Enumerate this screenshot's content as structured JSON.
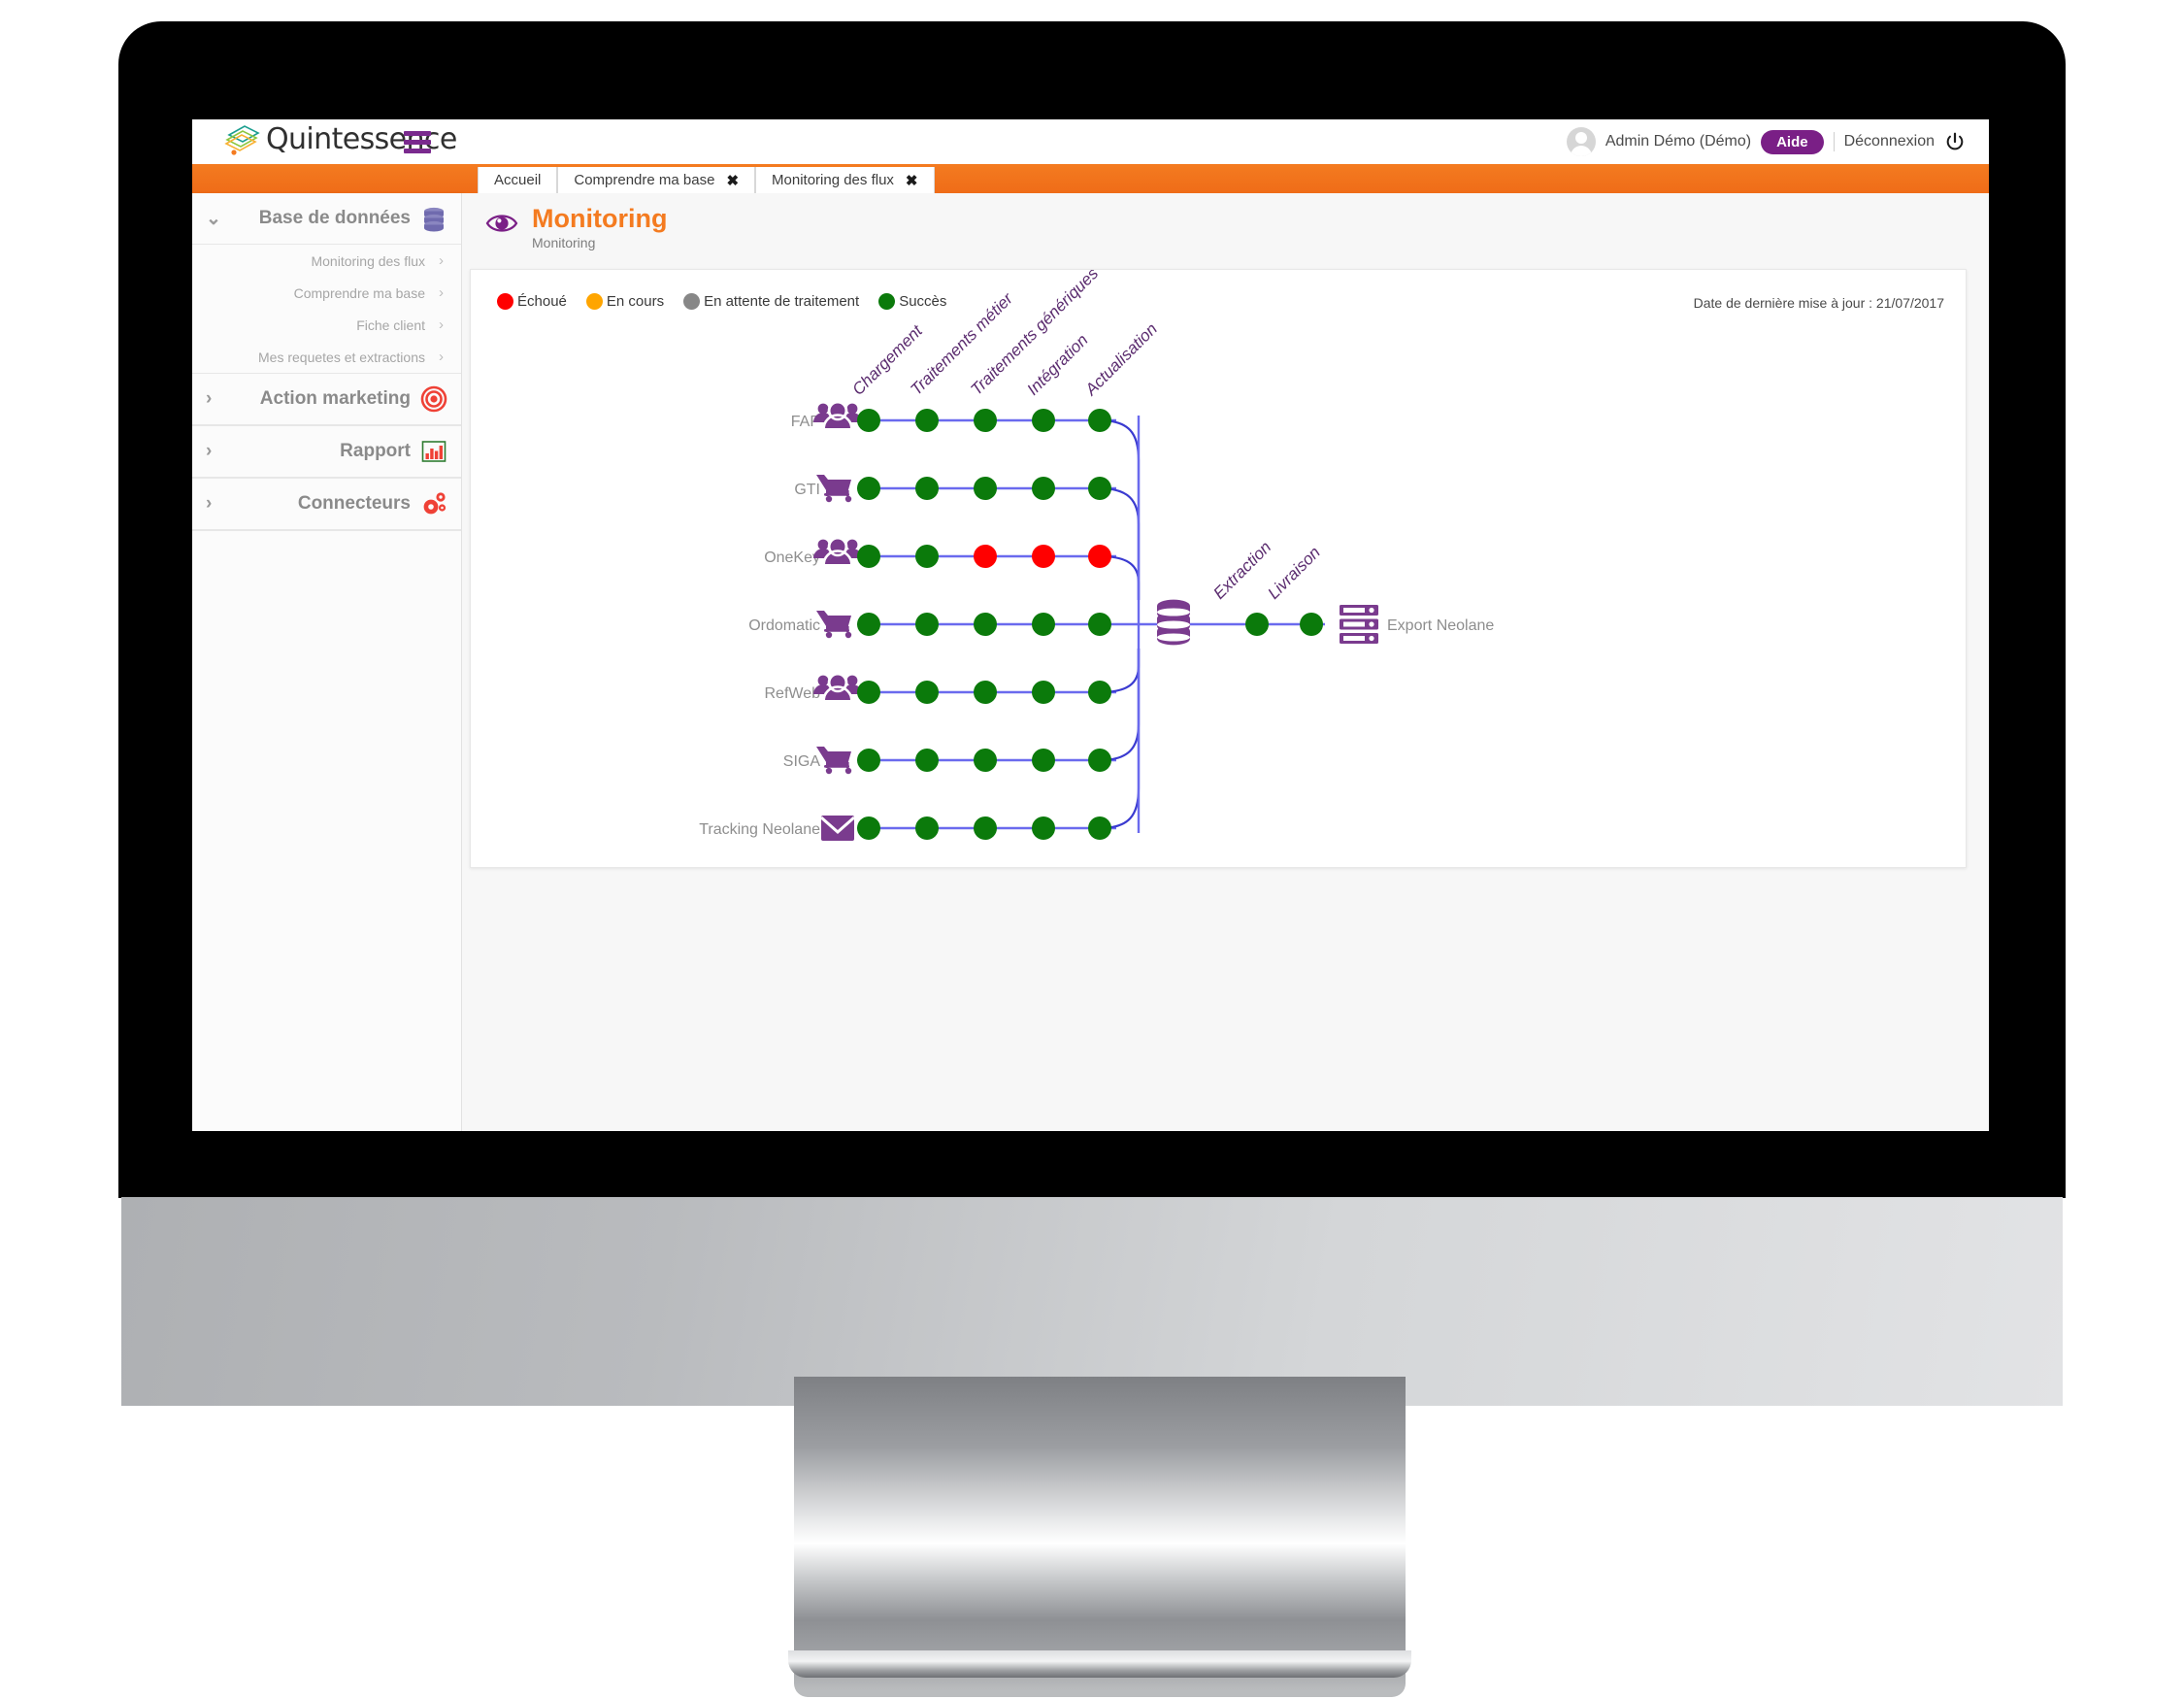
{
  "header": {
    "brand": "Quintessence",
    "menu_icon": "hamburger-icon",
    "user_name": "Admin Démo (Démo)",
    "help_label": "Aide",
    "logout_label": "Déconnexion",
    "power_icon": "power-icon",
    "accent_orange": "#f47b20",
    "accent_purple": "#7a1f86"
  },
  "tabs": [
    {
      "label": "Accueil",
      "closable": false
    },
    {
      "label": "Comprendre ma base",
      "closable": true,
      "close": "✖"
    },
    {
      "label": "Monitoring des flux",
      "closable": true,
      "close": "✖"
    }
  ],
  "sidebar": {
    "groups": [
      {
        "label": "Base de données",
        "icon": "database-icon",
        "caret": "⌄",
        "expanded": true,
        "items": [
          {
            "label": "Monitoring des flux",
            "chevron": "›"
          },
          {
            "label": "Comprendre ma base",
            "chevron": "›"
          },
          {
            "label": "Fiche client",
            "chevron": "›"
          },
          {
            "label": "Mes requetes et extractions",
            "chevron": "›"
          }
        ]
      },
      {
        "label": "Action marketing",
        "icon": "target-icon",
        "caret": "›",
        "expanded": false,
        "items": []
      },
      {
        "label": "Rapport",
        "icon": "bar-chart-icon",
        "caret": "›",
        "expanded": false,
        "items": []
      },
      {
        "label": "Connecteurs",
        "icon": "gears-icon",
        "caret": "›",
        "expanded": false,
        "items": []
      }
    ]
  },
  "page": {
    "icon": "eye-icon",
    "title": "Monitoring",
    "subtitle": "Monitoring"
  },
  "legend": [
    {
      "label": "Échoué",
      "color": "#ff0000"
    },
    {
      "label": "En cours",
      "color": "#ffa500"
    },
    {
      "label": "En attente de traitement",
      "color": "#878787"
    },
    {
      "label": "Succès",
      "color": "#0b7a0b"
    }
  ],
  "update_info": {
    "label": "Date de dernière mise à jour :",
    "value": "21/07/2017",
    "full": "Date de dernière mise à jour :  21/07/2017"
  },
  "chart_data": {
    "type": "diagram",
    "title": "Monitoring des flux",
    "stage_labels": [
      "Chargement",
      "Traitements métier",
      "Traitements génériques",
      "Intégration",
      "Actualisation"
    ],
    "output_stage_labels": [
      "Extraction",
      "Livraison"
    ],
    "status_colors": {
      "success": "#0b7a0b",
      "failed": "#ff0000",
      "running": "#ffa500",
      "pending": "#878787"
    },
    "sources": [
      {
        "name": "FAP",
        "icon": "people-icon",
        "statuses": [
          "success",
          "success",
          "success",
          "success",
          "success"
        ]
      },
      {
        "name": "GTI",
        "icon": "cart-icon",
        "statuses": [
          "success",
          "success",
          "success",
          "success",
          "success"
        ]
      },
      {
        "name": "OneKey",
        "icon": "people-icon",
        "statuses": [
          "success",
          "success",
          "failed",
          "failed",
          "failed"
        ]
      },
      {
        "name": "Ordomatic",
        "icon": "cart-icon",
        "statuses": [
          "success",
          "success",
          "success",
          "success",
          "success"
        ]
      },
      {
        "name": "RefWeb",
        "icon": "people-icon",
        "statuses": [
          "success",
          "success",
          "success",
          "success",
          "success"
        ]
      },
      {
        "name": "SIGA",
        "icon": "cart-icon",
        "statuses": [
          "success",
          "success",
          "success",
          "success",
          "success"
        ]
      },
      {
        "name": "Tracking Neolane",
        "icon": "envelope-icon",
        "statuses": [
          "success",
          "success",
          "success",
          "success",
          "success"
        ]
      }
    ],
    "database_node": {
      "icon": "database-icon"
    },
    "output": {
      "name": "Export Neolane",
      "icon": "server-icon",
      "statuses": [
        "success",
        "success"
      ]
    },
    "link_color": "#6a6aee",
    "node_color": "#7a3b8e"
  }
}
